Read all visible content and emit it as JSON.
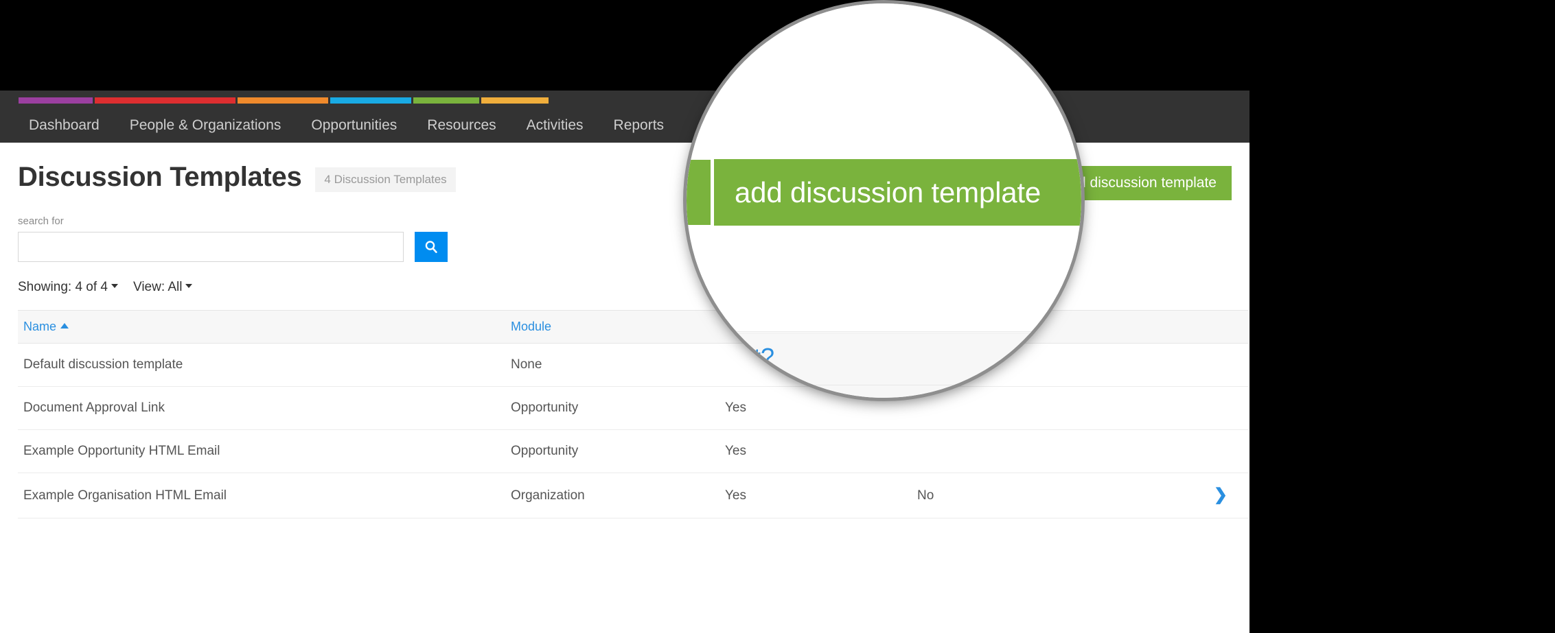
{
  "nav": {
    "items": [
      {
        "label": "Dashboard"
      },
      {
        "label": "People & Organizations"
      },
      {
        "label": "Opportunities"
      },
      {
        "label": "Resources"
      },
      {
        "label": "Activities"
      },
      {
        "label": "Reports"
      }
    ],
    "stripe_colors": [
      "#9b3fa0",
      "#dd2e30",
      "#f08a2c",
      "#19aae4",
      "#7ab33d",
      "#f0ae3c"
    ],
    "bar_color": "#333333"
  },
  "header": {
    "title": "Discussion Templates",
    "count_badge": "4 Discussion Templates",
    "add_button": "add discussion template"
  },
  "search": {
    "label": "search for",
    "value": "",
    "placeholder": "",
    "button_icon": "search-icon"
  },
  "toolbar": {
    "showing": "Showing: 4 of 4",
    "view": "View: All"
  },
  "table": {
    "columns": [
      {
        "label": "Name",
        "sorted": "asc"
      },
      {
        "label": "Module",
        "sorted": ""
      },
      {
        "label": "",
        "sorted": ""
      },
      {
        "label": "",
        "sorted": ""
      },
      {
        "label": "",
        "sorted": ""
      }
    ],
    "rows": [
      {
        "name": "Default discussion template",
        "module": "None",
        "html": "",
        "default": "",
        "action": ""
      },
      {
        "name": "Document Approval Link",
        "module": "Opportunity",
        "html": "Yes",
        "default": "",
        "action": ""
      },
      {
        "name": "Example Opportunity HTML Email",
        "module": "Opportunity",
        "html": "Yes",
        "default": "",
        "action": ""
      },
      {
        "name": "Example Organisation HTML Email",
        "module": "Organization",
        "html": "Yes",
        "default": "No",
        "action": "chevron-down-icon"
      }
    ]
  },
  "lens": {
    "magnified_button": "add discussion template",
    "magnified_link_fragment": "lt?",
    "button_color": "#7ab33d",
    "link_color": "#2a8fe0"
  }
}
